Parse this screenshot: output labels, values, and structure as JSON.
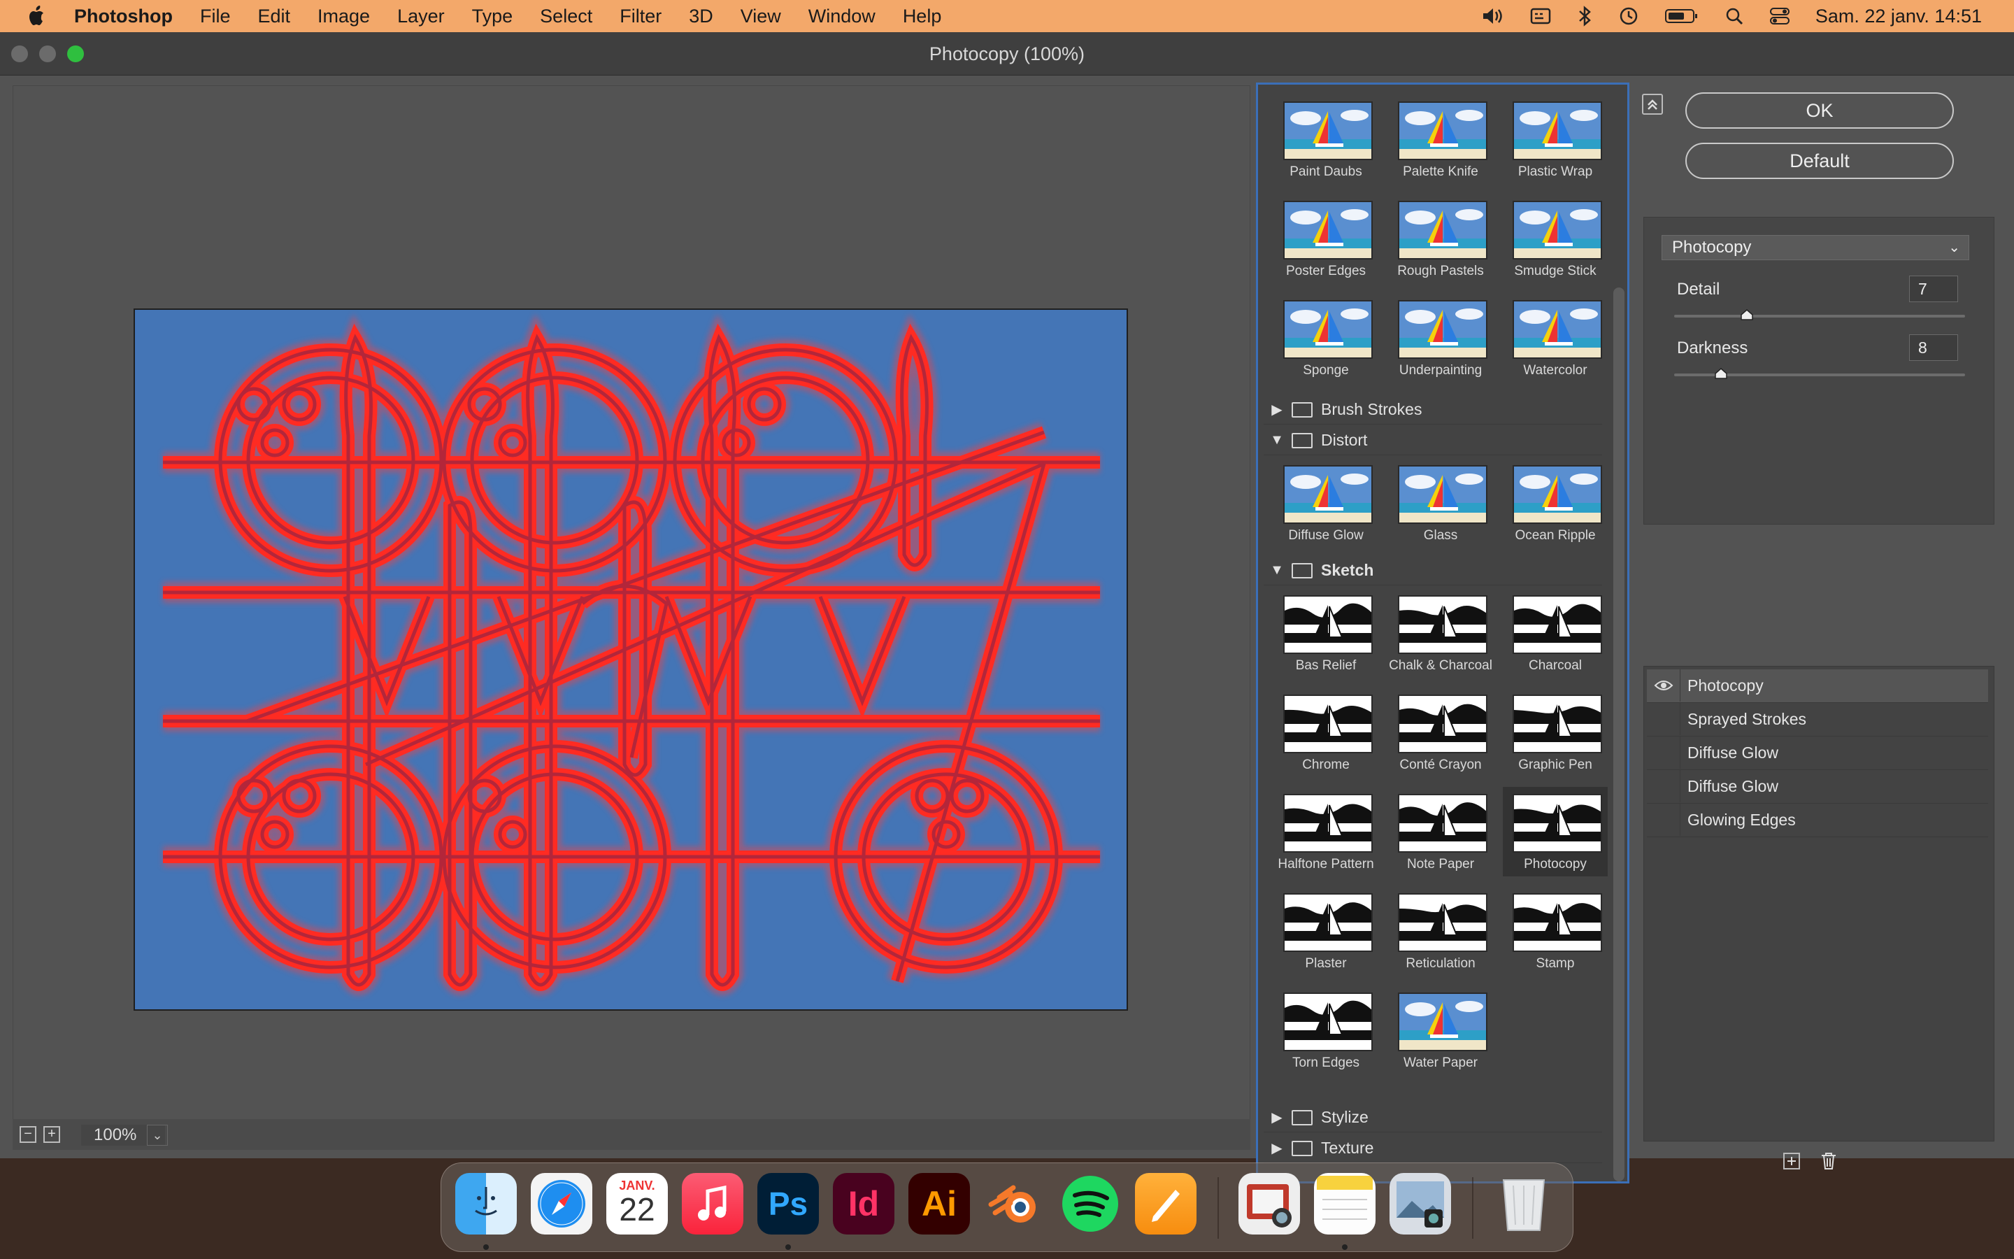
{
  "menubar": {
    "app_name": "Photoshop",
    "items": [
      "File",
      "Edit",
      "Image",
      "Layer",
      "Type",
      "Select",
      "Filter",
      "3D",
      "View",
      "Window",
      "Help"
    ],
    "clock": "Sam. 22 janv.  14:51"
  },
  "window": {
    "title": "Photocopy (100%)"
  },
  "preview": {
    "zoom": "100%"
  },
  "gallery": {
    "top_thumbs": [
      {
        "label": "Paint Daubs",
        "style": "color"
      },
      {
        "label": "Palette Knife",
        "style": "color"
      },
      {
        "label": "Plastic Wrap",
        "style": "color"
      },
      {
        "label": "Poster Edges",
        "style": "color"
      },
      {
        "label": "Rough Pastels",
        "style": "color"
      },
      {
        "label": "Smudge Stick",
        "style": "color"
      },
      {
        "label": "Sponge",
        "style": "color"
      },
      {
        "label": "Underpainting",
        "style": "color"
      },
      {
        "label": "Watercolor",
        "style": "color"
      }
    ],
    "folders": {
      "brush_strokes": "Brush Strokes",
      "distort": "Distort",
      "sketch": "Sketch",
      "stylize": "Stylize",
      "texture": "Texture"
    },
    "distort_thumbs": [
      {
        "label": "Diffuse Glow",
        "style": "color"
      },
      {
        "label": "Glass",
        "style": "color"
      },
      {
        "label": "Ocean Ripple",
        "style": "color"
      }
    ],
    "sketch_thumbs": [
      {
        "label": "Bas Relief",
        "style": "bw"
      },
      {
        "label": "Chalk & Charcoal",
        "style": "bw"
      },
      {
        "label": "Charcoal",
        "style": "bw"
      },
      {
        "label": "Chrome",
        "style": "bw"
      },
      {
        "label": "Conté Crayon",
        "style": "bw"
      },
      {
        "label": "Graphic Pen",
        "style": "bw"
      },
      {
        "label": "Halftone Pattern",
        "style": "bw"
      },
      {
        "label": "Note Paper",
        "style": "bw"
      },
      {
        "label": "Photocopy",
        "style": "bw",
        "selected": true
      },
      {
        "label": "Plaster",
        "style": "bw"
      },
      {
        "label": "Reticulation",
        "style": "bw"
      },
      {
        "label": "Stamp",
        "style": "bw"
      },
      {
        "label": "Torn Edges",
        "style": "bw"
      },
      {
        "label": "Water Paper",
        "style": "color"
      }
    ]
  },
  "controls": {
    "ok_label": "OK",
    "default_label": "Default",
    "filter_selected": "Photocopy",
    "params": [
      {
        "label": "Detail",
        "value": "7",
        "fraction": 0.25
      },
      {
        "label": "Darkness",
        "value": "8",
        "fraction": 0.16
      }
    ]
  },
  "effect_layers": [
    "Photocopy",
    "Sprayed Strokes",
    "Diffuse Glow",
    "Diffuse Glow",
    "Glowing Edges"
  ],
  "dock": {
    "calendar_month": "JANV.",
    "calendar_day": "22",
    "apps": [
      "finder-icon",
      "safari-icon",
      "calendar-icon",
      "music-icon",
      "photoshop-icon",
      "indesign-icon",
      "illustrator-icon",
      "blender-icon",
      "spotify-icon",
      "pages-icon",
      "preview-icon",
      "notes-icon",
      "photos-icon",
      "trash-icon"
    ],
    "ps_label": "Ps",
    "id_label": "Id",
    "ai_label": "Ai"
  },
  "colors": {
    "menubar": "#f3a86a",
    "artboard": "#4475b6",
    "pattern": "#e8322c",
    "selection_border": "#3b6fb8"
  }
}
